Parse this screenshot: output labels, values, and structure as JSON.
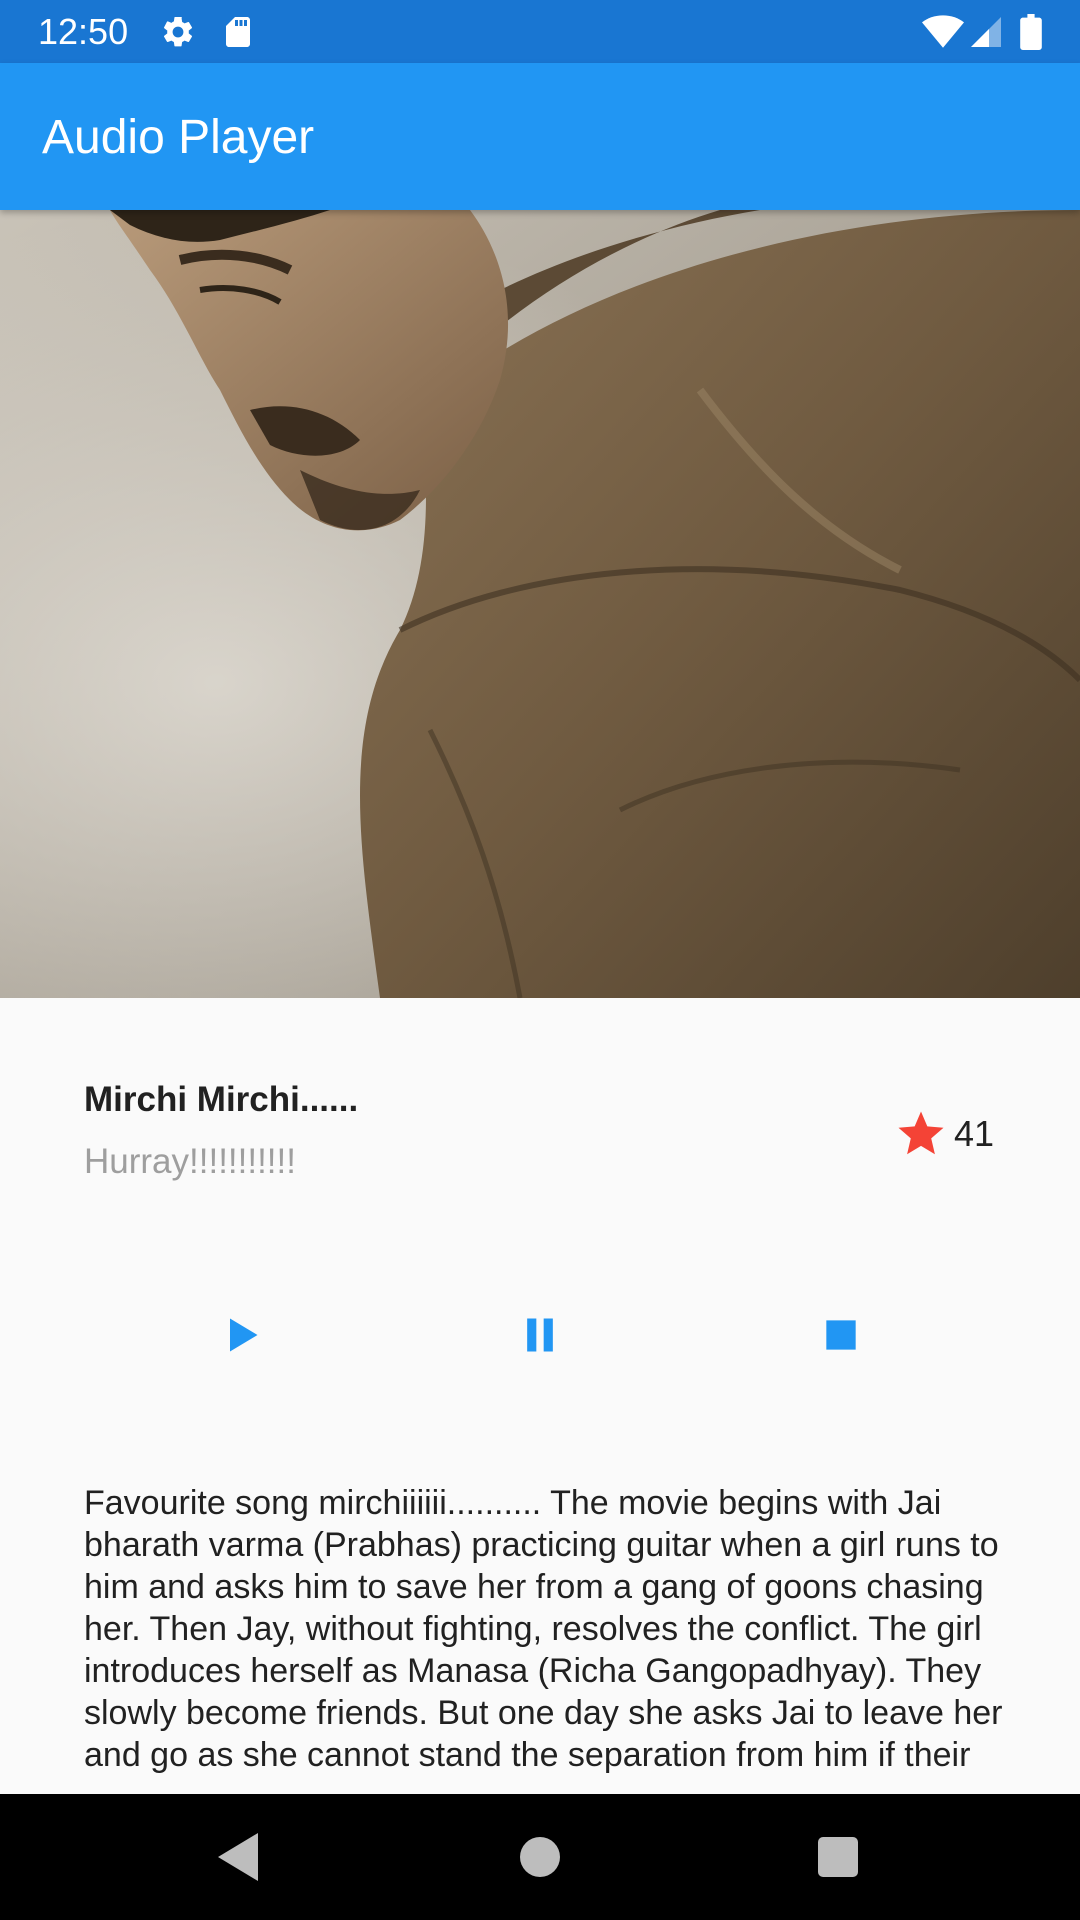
{
  "status_bar": {
    "time": "12:50",
    "left_icons": [
      "gear-icon",
      "sd-card-icon"
    ],
    "right_icons": [
      "wifi-icon",
      "signal-icon",
      "battery-icon"
    ]
  },
  "app_bar": {
    "title": "Audio Player"
  },
  "hero": {
    "image": "album-art-photo"
  },
  "song": {
    "title": "Mirchi Mirchi......",
    "subtitle": "Hurray!!!!!!!!!!!",
    "rating_count": "41"
  },
  "controls": {
    "play": "play-icon",
    "pause": "pause-icon",
    "stop": "stop-icon"
  },
  "description": "Favourite song mirchiiiiii.......... The movie begins with Jai bharath varma (Prabhas) practicing guitar when a girl runs to him and asks him to save her from a gang of goons chasing her. Then Jay, without fighting, resolves the conflict. The girl introduces herself as Manasa (Richa Gangopadhyay). They slowly become friends. But one day she asks Jai to leave her and go as she cannot stand the separation from him if their",
  "nav_bar": {
    "back": "back-icon",
    "home": "home-icon",
    "recents": "recents-icon"
  },
  "colors": {
    "status_bar": "#1976d2",
    "app_bar": "#2196f3",
    "accent": "#2196f3",
    "star": "#f44336",
    "background": "#fafafa",
    "subtitle": "#9e9e9e"
  }
}
